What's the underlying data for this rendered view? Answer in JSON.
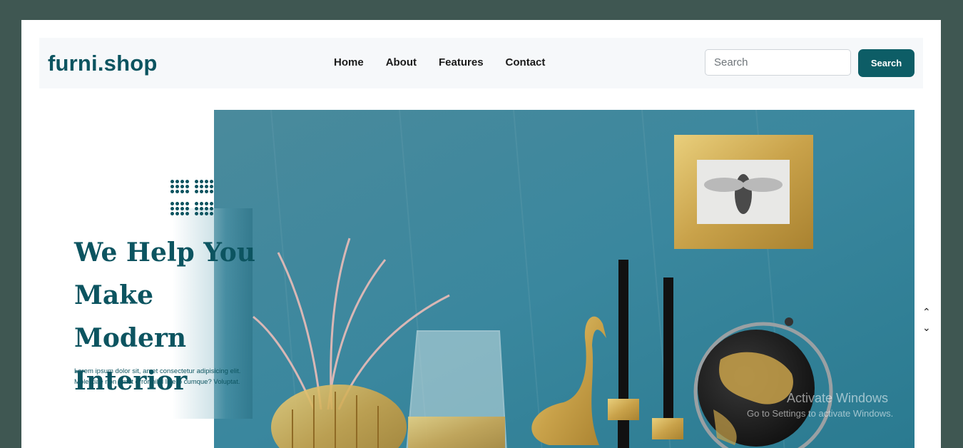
{
  "brand": {
    "name": "furni.shop"
  },
  "nav": {
    "links": [
      "Home",
      "About",
      "Features",
      "Contact"
    ]
  },
  "search": {
    "placeholder": "Search",
    "value": "",
    "button_label": "Search"
  },
  "hero": {
    "title_lines": [
      "We Help You",
      "Make Modern",
      "Interior"
    ],
    "description": "Lorem ipsum dolor sit, amet consectetur adipisicing elit. Molestiae non amet error nihil libero cumque? Voluptat.",
    "image_alt": "Decorative interior with vase, glass, brass swan, candles, framed bee print and globe"
  },
  "scroll": {
    "up_icon": "chevron-up-icon",
    "down_icon": "chevron-down-icon"
  },
  "watermark": {
    "title": "Activate Windows",
    "subtitle": "Go to Settings to activate Windows."
  },
  "colors": {
    "background": "#3f5752",
    "brand": "#0c5460",
    "button": "#0d5d66",
    "navbar": "#f6f8fa"
  }
}
